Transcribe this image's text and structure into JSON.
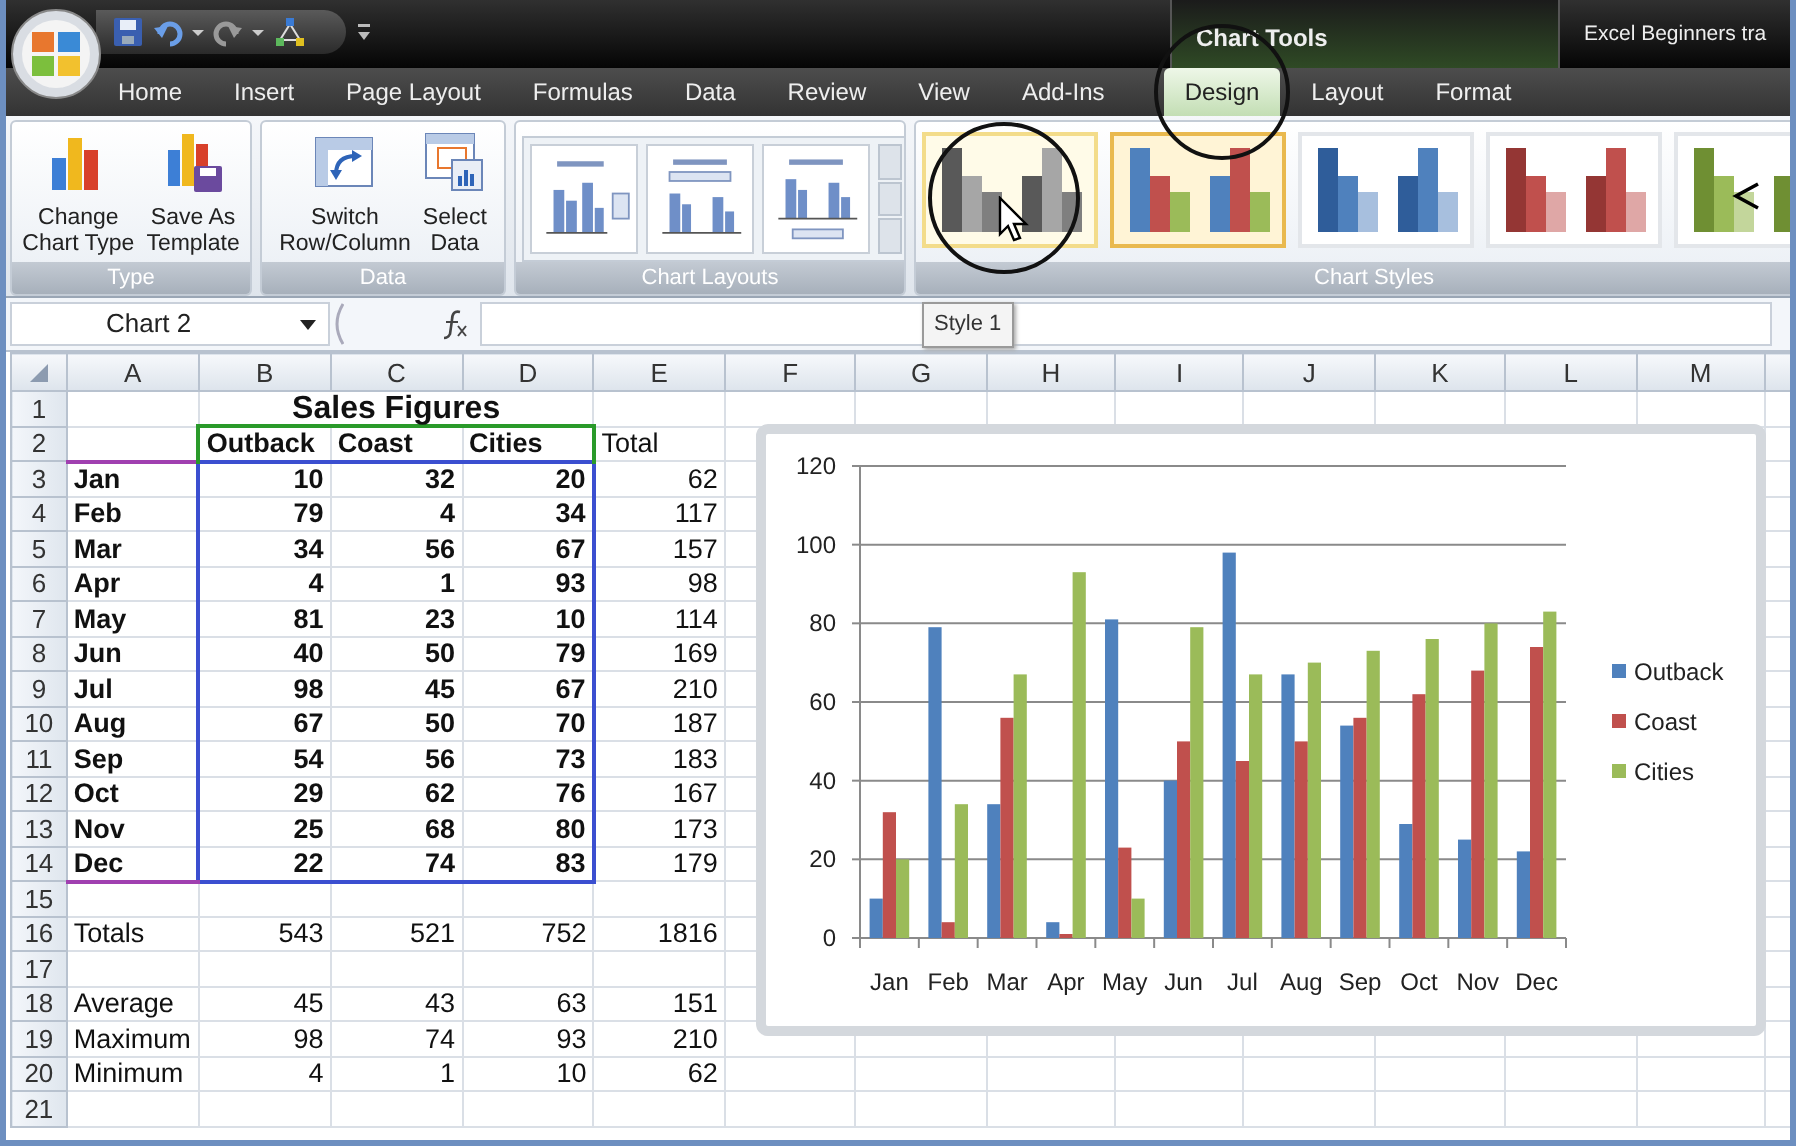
{
  "title_bar": {
    "context_label": "Chart Tools",
    "title": "Excel Beginners tra"
  },
  "tabs": [
    {
      "label": "Home",
      "kind": "standard",
      "selected": false,
      "circled": false
    },
    {
      "label": "Insert",
      "kind": "standard",
      "selected": false,
      "circled": false
    },
    {
      "label": "Page Layout",
      "kind": "standard",
      "selected": false,
      "circled": false
    },
    {
      "label": "Formulas",
      "kind": "standard",
      "selected": false,
      "circled": false
    },
    {
      "label": "Data",
      "kind": "standard",
      "selected": false,
      "circled": false
    },
    {
      "label": "Review",
      "kind": "standard",
      "selected": false,
      "circled": false
    },
    {
      "label": "View",
      "kind": "standard",
      "selected": false,
      "circled": false
    },
    {
      "label": "Add-Ins",
      "kind": "standard",
      "selected": false,
      "circled": false
    },
    {
      "label": "Design",
      "kind": "contextual",
      "selected": true,
      "circled": true
    },
    {
      "label": "Layout",
      "kind": "contextual",
      "selected": false,
      "circled": false
    },
    {
      "label": "Format",
      "kind": "contextual",
      "selected": false,
      "circled": false
    }
  ],
  "ribbon": {
    "groups": [
      {
        "label": "Type",
        "kind": "buttons",
        "buttons": [
          {
            "kind": "change-chart",
            "lines": [
              "Change",
              "Chart Type"
            ]
          },
          {
            "kind": "save-template",
            "lines": [
              "Save As",
              "Template"
            ]
          }
        ]
      },
      {
        "label": "Data",
        "kind": "buttons",
        "buttons": [
          {
            "kind": "switch",
            "lines": [
              "Switch",
              "Row/Column"
            ]
          },
          {
            "kind": "select-data",
            "lines": [
              "Select",
              "Data"
            ]
          }
        ]
      },
      {
        "label": "Chart Layouts",
        "kind": "layouts",
        "items": [
          {
            "kind": "legend-right"
          },
          {
            "kind": "title-top"
          },
          {
            "kind": "legend-bottom"
          }
        ]
      },
      {
        "label": "Chart Styles",
        "kind": "styles",
        "items": [
          {
            "kind": "grayscale",
            "selected": false,
            "hovered": true,
            "circled": true,
            "cursor": true,
            "arrow": false
          },
          {
            "kind": "colorful",
            "selected": true,
            "hovered": false,
            "circled": false,
            "cursor": false,
            "arrow": false
          },
          {
            "kind": "blue",
            "selected": false,
            "hovered": false,
            "circled": false,
            "cursor": false,
            "arrow": false
          },
          {
            "kind": "red",
            "selected": false,
            "hovered": false,
            "circled": false,
            "cursor": false,
            "arrow": false
          },
          {
            "kind": "green",
            "selected": false,
            "hovered": false,
            "circled": false,
            "cursor": false,
            "arrow": true
          }
        ]
      }
    ]
  },
  "tooltip": "Style 1",
  "formula_bar": {
    "name_box": "Chart 2"
  },
  "sheet": {
    "columns": [
      "A",
      "B",
      "C",
      "D",
      "E",
      "F",
      "G",
      "H",
      "I",
      "J",
      "K",
      "L",
      "M"
    ],
    "rows": [
      {
        "number": "1",
        "kind": "title",
        "title": "Sales Figures"
      },
      {
        "number": "2",
        "kind": "header",
        "values": [
          "Outback",
          "Coast",
          "Cities",
          "Total"
        ]
      },
      {
        "number": "3",
        "kind": "data",
        "label": "Jan",
        "values": [
          "10",
          "32",
          "20",
          "62"
        ]
      },
      {
        "number": "4",
        "kind": "data",
        "label": "Feb",
        "values": [
          "79",
          "4",
          "34",
          "117"
        ]
      },
      {
        "number": "5",
        "kind": "data",
        "label": "Mar",
        "values": [
          "34",
          "56",
          "67",
          "157"
        ]
      },
      {
        "number": "6",
        "kind": "data",
        "label": "Apr",
        "values": [
          "4",
          "1",
          "93",
          "98"
        ]
      },
      {
        "number": "7",
        "kind": "data",
        "label": "May",
        "values": [
          "81",
          "23",
          "10",
          "114"
        ]
      },
      {
        "number": "8",
        "kind": "data",
        "label": "Jun",
        "values": [
          "40",
          "50",
          "79",
          "169"
        ]
      },
      {
        "number": "9",
        "kind": "data",
        "label": "Jul",
        "values": [
          "98",
          "45",
          "67",
          "210"
        ]
      },
      {
        "number": "10",
        "kind": "data",
        "label": "Aug",
        "values": [
          "67",
          "50",
          "70",
          "187"
        ]
      },
      {
        "number": "11",
        "kind": "data",
        "label": "Sep",
        "values": [
          "54",
          "56",
          "73",
          "183"
        ]
      },
      {
        "number": "12",
        "kind": "data",
        "label": "Oct",
        "values": [
          "29",
          "62",
          "76",
          "167"
        ]
      },
      {
        "number": "13",
        "kind": "data",
        "label": "Nov",
        "values": [
          "25",
          "68",
          "80",
          "173"
        ]
      },
      {
        "number": "14",
        "kind": "data",
        "label": "Dec",
        "values": [
          "22",
          "74",
          "83",
          "179"
        ]
      },
      {
        "number": "15",
        "kind": "blank"
      },
      {
        "number": "16",
        "kind": "summary",
        "label": "Totals",
        "values": [
          "543",
          "521",
          "752",
          "1816"
        ]
      },
      {
        "number": "17",
        "kind": "blank"
      },
      {
        "number": "18",
        "kind": "summary",
        "label": "Average",
        "values": [
          "45",
          "43",
          "63",
          "151"
        ]
      },
      {
        "number": "19",
        "kind": "summary",
        "label": "Maximum",
        "values": [
          "98",
          "74",
          "93",
          "210"
        ]
      },
      {
        "number": "20",
        "kind": "summary",
        "label": "Minimum",
        "values": [
          "4",
          "1",
          "10",
          "62"
        ]
      },
      {
        "number": "21",
        "kind": "blank"
      }
    ]
  },
  "chart": {
    "chart_data": {
      "type": "bar",
      "categories": [
        "Jan",
        "Feb",
        "Mar",
        "Apr",
        "May",
        "Jun",
        "Jul",
        "Aug",
        "Sep",
        "Oct",
        "Nov",
        "Dec"
      ],
      "ylim": [
        0,
        120
      ],
      "grid": true,
      "legend": "right",
      "yticks": [
        0,
        20,
        40,
        60,
        80,
        100,
        120
      ],
      "series": [
        {
          "name": "Outback",
          "color": "#4f81bd",
          "values": [
            10,
            79,
            34,
            4,
            81,
            40,
            98,
            67,
            54,
            29,
            25,
            22
          ]
        },
        {
          "name": "Coast",
          "color": "#c0504d",
          "values": [
            32,
            4,
            56,
            1,
            23,
            50,
            45,
            50,
            56,
            62,
            68,
            74
          ]
        },
        {
          "name": "Cities",
          "color": "#9bbb59",
          "values": [
            20,
            34,
            67,
            93,
            10,
            79,
            67,
            70,
            73,
            76,
            80,
            83
          ]
        }
      ]
    }
  }
}
